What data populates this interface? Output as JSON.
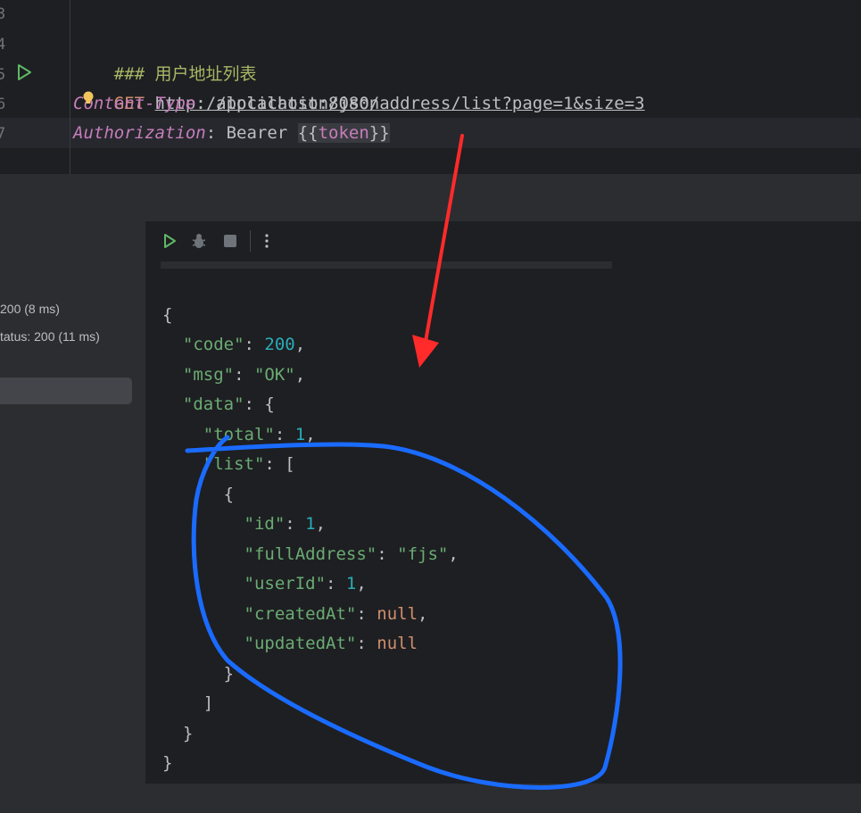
{
  "editor": {
    "line_numbers": [
      "3",
      "4",
      "5",
      "6",
      "7"
    ],
    "comment": "### 用户地址列表",
    "method": "GET",
    "url": "http://localhost:8080/address/list?page=1&size=3",
    "header1_name": "Content-Type",
    "header1_sep": ":",
    "header1_value": " application/json",
    "header2_name": "Authorization",
    "header2_sep": ":",
    "header2_value": " Bearer ",
    "tpl_open": "{{",
    "tpl_var": "token",
    "tpl_close": "}}"
  },
  "history": {
    "items": [
      "200 (8 ms)",
      "tatus: 200 (11 ms)"
    ]
  },
  "toolbar": {
    "buttons": [
      "run-icon",
      "debug-icon",
      "stop-icon",
      "more-icon"
    ]
  },
  "response": {
    "open_brace": "{",
    "code_key": "\"code\"",
    "code_value": "200",
    "msg_key": "\"msg\"",
    "msg_value": "\"OK\"",
    "data_key": "\"data\"",
    "total_key": "\"total\"",
    "total_value": "1",
    "list_key": "\"list\"",
    "item_open": "{",
    "id_key": "\"id\"",
    "id_value": "1",
    "fullAddress_key": "\"fullAddress\"",
    "fullAddress_value": "\"fjs\"",
    "userId_key": "\"userId\"",
    "userId_value": "1",
    "createdAt_key": "\"createdAt\"",
    "createdAt_value": "null",
    "updatedAt_key": "\"updatedAt\"",
    "updatedAt_value": "null",
    "item_close": "}",
    "list_close": "]",
    "data_close": "}",
    "close_brace": "}"
  },
  "colors": {
    "arrow": "#ff2a2a",
    "circle": "#1a6bff"
  }
}
